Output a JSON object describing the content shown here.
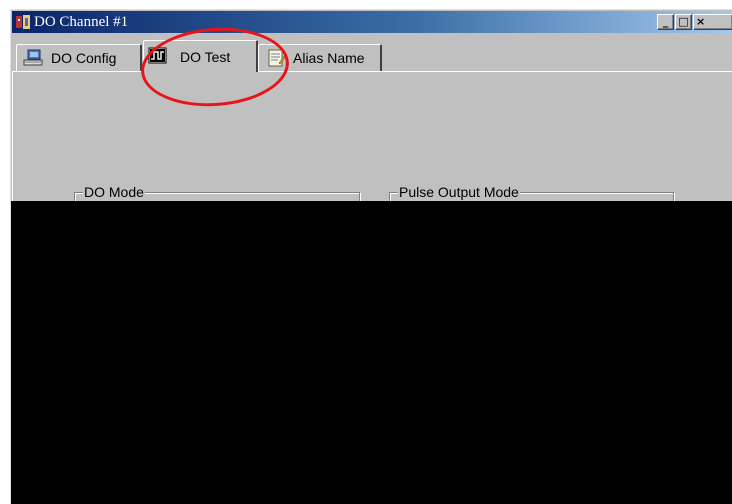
{
  "window": {
    "title": "DO Channel #1",
    "controls": {
      "minimize": "_",
      "maximize": "□",
      "close": "×"
    }
  },
  "tabs": [
    {
      "label": "DO Config",
      "icon": "network-config-icon",
      "active": false
    },
    {
      "label": "DO Test",
      "icon": "digital-signal-icon",
      "active": true
    },
    {
      "label": "Alias Name",
      "icon": "notepad-icon",
      "active": false
    }
  ],
  "groups": {
    "do_mode": {
      "label": "DO Mode"
    },
    "pulse_output_mode": {
      "label": "Pulse Output Mode"
    }
  },
  "colors": {
    "face": "#c0c0c0",
    "annotation": "#e8141a",
    "title_gradient_start": "#0a246a"
  }
}
